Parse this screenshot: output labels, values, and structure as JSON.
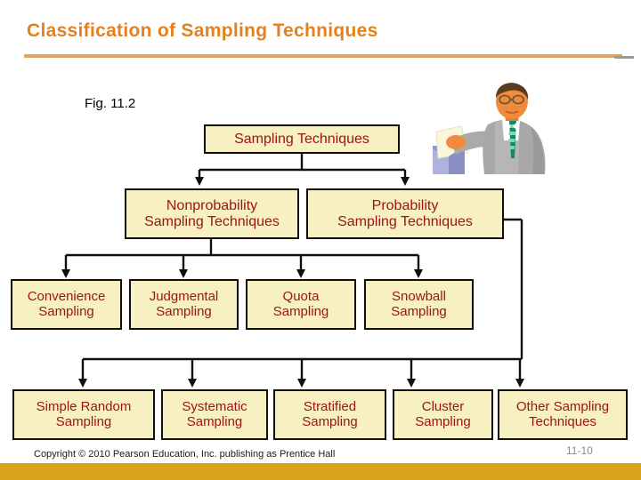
{
  "slide": {
    "title": "Classification of Sampling Techniques",
    "figure_caption": "Fig. 11.2",
    "accent_color": "#E2811E",
    "rule_color": "#E2A458",
    "box_fill": "#F7F0C3",
    "box_border": "#120E08",
    "box_text_color": "#9C1313",
    "bottom_bar_color": "#D9A21B"
  },
  "diagram": {
    "type": "tree",
    "levels": [
      {
        "level": 1,
        "nodes": [
          {
            "id": "sampling-techniques",
            "label": "Sampling Techniques"
          }
        ]
      },
      {
        "level": 2,
        "nodes": [
          {
            "id": "nonprobability",
            "label": "Nonprobability\nSampling Techniques"
          },
          {
            "id": "probability",
            "label": "Probability\nSampling Techniques"
          }
        ]
      },
      {
        "level": 3,
        "parent": "nonprobability",
        "nodes": [
          {
            "id": "convenience",
            "label": "Convenience\nSampling"
          },
          {
            "id": "judgmental",
            "label": "Judgmental\nSampling"
          },
          {
            "id": "quota",
            "label": "Quota\nSampling"
          },
          {
            "id": "snowball",
            "label": "Snowball\nSampling"
          }
        ]
      },
      {
        "level": 4,
        "parent": "probability",
        "nodes": [
          {
            "id": "simple-random",
            "label": "Simple Random\nSampling"
          },
          {
            "id": "systematic",
            "label": "Systematic\nSampling"
          },
          {
            "id": "stratified",
            "label": "Stratified\nSampling"
          },
          {
            "id": "cluster",
            "label": "Cluster\nSampling"
          },
          {
            "id": "other",
            "label": "Other Sampling\nTechniques"
          }
        ]
      }
    ]
  },
  "clipart": {
    "name": "businessman-with-ballot-box",
    "description": "Man in gray suit with green striped tie placing papers into a light blue box"
  },
  "footer": {
    "copyright": "Copyright © 2010 Pearson Education, Inc. publishing as Prentice Hall",
    "page_number": "11-10"
  }
}
